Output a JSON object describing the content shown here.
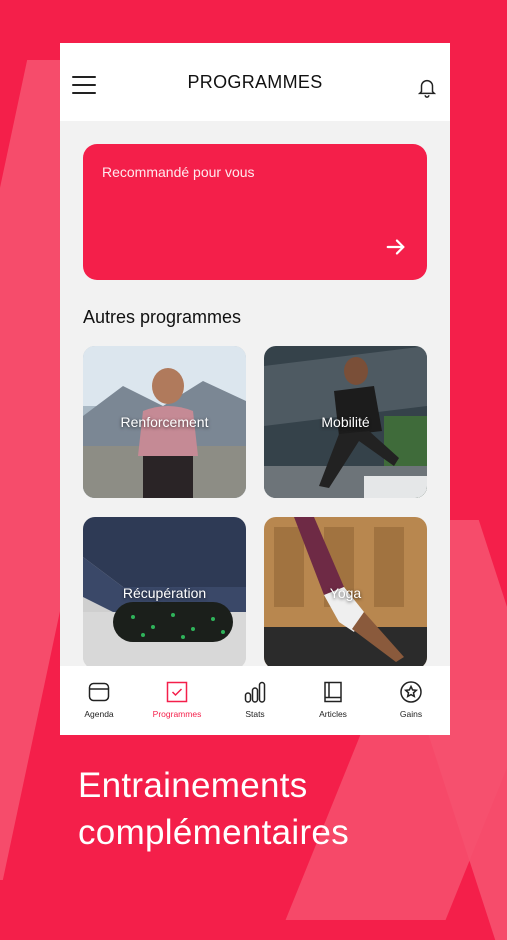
{
  "header": {
    "title": "PROGRAMMES"
  },
  "recommended": {
    "label": "Recommandé pour vous"
  },
  "section": {
    "title": "Autres programmes"
  },
  "programs": [
    {
      "label": "Renforcement"
    },
    {
      "label": "Mobilité"
    },
    {
      "label": "Récupération"
    },
    {
      "label": "Yoga"
    }
  ],
  "tabs": [
    {
      "label": "Agenda",
      "icon": "calendar-icon",
      "active": false
    },
    {
      "label": "Programmes",
      "icon": "checkbox-icon",
      "active": true
    },
    {
      "label": "Stats",
      "icon": "bar-chart-icon",
      "active": false
    },
    {
      "label": "Articles",
      "icon": "book-icon",
      "active": false
    },
    {
      "label": "Gains",
      "icon": "star-badge-icon",
      "active": false
    }
  ],
  "promo": {
    "line1": "Entrainements",
    "line2": "complémentaires"
  },
  "colors": {
    "accent": "#f41f4a",
    "accent_light": "#f6516f"
  }
}
